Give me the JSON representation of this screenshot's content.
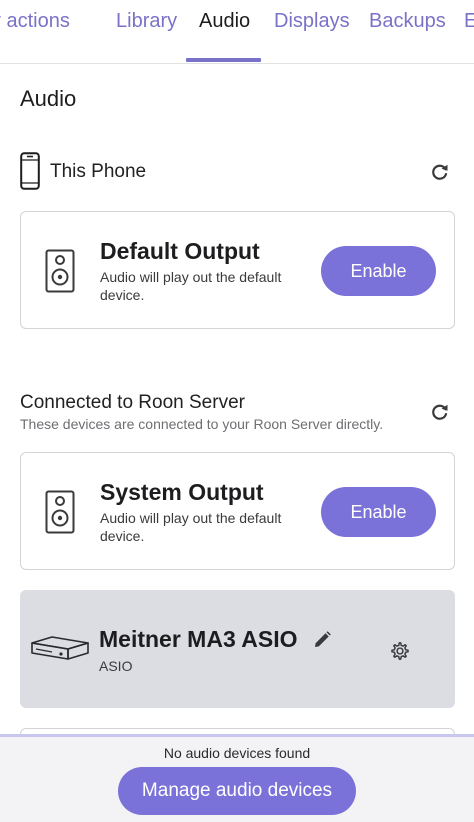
{
  "tabs": [
    {
      "label": "Play actions",
      "active": false
    },
    {
      "label": "Library",
      "active": false
    },
    {
      "label": "Audio",
      "active": true
    },
    {
      "label": "Displays",
      "active": false
    },
    {
      "label": "Backups",
      "active": false
    },
    {
      "label": "E",
      "active": false
    }
  ],
  "page": {
    "title": "Audio"
  },
  "this_phone": {
    "label": "This Phone",
    "icons": {
      "device": "phone-icon",
      "refresh": "refresh-icon"
    },
    "card": {
      "title": "Default Output",
      "description": "Audio will play out the default device.",
      "button_label": "Enable",
      "icon": "speaker-icon"
    }
  },
  "roon_server": {
    "label": "Connected to Roon Server",
    "sublabel": "These devices are connected to your Roon Server directly.",
    "icons": {
      "refresh": "refresh-icon"
    },
    "system_card": {
      "title": "System Output",
      "description": "Audio will play out the default device.",
      "button_label": "Enable",
      "icon": "speaker-icon"
    },
    "device_card": {
      "title": "Meitner MA3 ASIO",
      "subtitle": "ASIO",
      "icons": {
        "device": "dac-icon",
        "edit": "pencil-icon",
        "settings": "gear-icon"
      }
    }
  },
  "bottom": {
    "status": "No audio devices found",
    "button_label": "Manage audio devices"
  },
  "colors": {
    "accent": "#7a72d9",
    "tab_text": "#7a72c8",
    "device_card_bg": "#dcdde3"
  }
}
